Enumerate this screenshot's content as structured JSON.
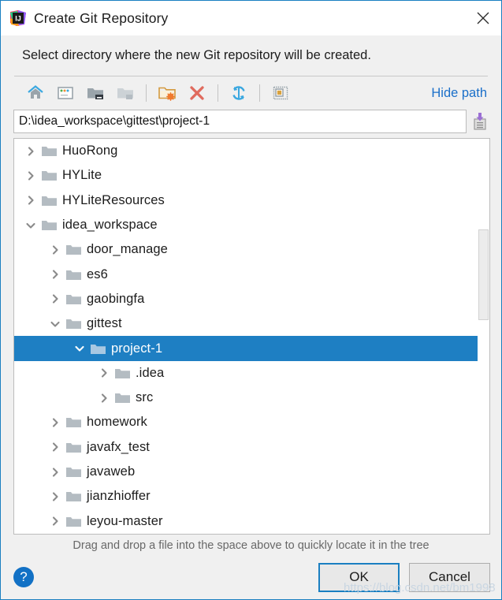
{
  "window": {
    "title": "Create Git Repository",
    "app_icon": "intellij-idea-icon",
    "close_icon": "close-icon"
  },
  "prompt": "Select directory where the new Git repository will be created.",
  "toolbar": {
    "buttons": [
      {
        "name": "home-icon",
        "tooltip": "Home"
      },
      {
        "name": "desktop-icon",
        "tooltip": "Desktop"
      },
      {
        "name": "project-folder-icon",
        "tooltip": "Project Directory"
      },
      {
        "name": "module-folder-icon",
        "tooltip": "Module Directory"
      },
      {
        "name": "new-folder-icon",
        "tooltip": "New Folder"
      },
      {
        "name": "delete-icon",
        "tooltip": "Delete"
      },
      {
        "name": "refresh-icon",
        "tooltip": "Refresh"
      },
      {
        "name": "show-hidden-icon",
        "tooltip": "Show Hidden Files"
      }
    ],
    "hide_path_label": "Hide path"
  },
  "path": {
    "value": "D:\\idea_workspace\\gittest\\project-1",
    "placeholder": "",
    "paste_icon": "paste-from-clipboard-icon"
  },
  "tree": {
    "rows": [
      {
        "label": "HuoRong",
        "depth": 1,
        "state": "collapsed",
        "selected": false
      },
      {
        "label": "HYLite",
        "depth": 1,
        "state": "collapsed",
        "selected": false
      },
      {
        "label": "HYLiteResources",
        "depth": 1,
        "state": "collapsed",
        "selected": false
      },
      {
        "label": "idea_workspace",
        "depth": 1,
        "state": "expanded",
        "selected": false
      },
      {
        "label": "door_manage",
        "depth": 2,
        "state": "collapsed",
        "selected": false
      },
      {
        "label": "es6",
        "depth": 2,
        "state": "collapsed",
        "selected": false
      },
      {
        "label": "gaobingfa",
        "depth": 2,
        "state": "collapsed",
        "selected": false
      },
      {
        "label": "gittest",
        "depth": 2,
        "state": "expanded",
        "selected": false
      },
      {
        "label": "project-1",
        "depth": 3,
        "state": "expanded",
        "selected": true
      },
      {
        "label": ".idea",
        "depth": 4,
        "state": "collapsed",
        "selected": false
      },
      {
        "label": "src",
        "depth": 4,
        "state": "collapsed",
        "selected": false
      },
      {
        "label": "homework",
        "depth": 2,
        "state": "collapsed",
        "selected": false
      },
      {
        "label": "javafx_test",
        "depth": 2,
        "state": "collapsed",
        "selected": false
      },
      {
        "label": "javaweb",
        "depth": 2,
        "state": "collapsed",
        "selected": false
      },
      {
        "label": "jianzhioffer",
        "depth": 2,
        "state": "collapsed",
        "selected": false
      },
      {
        "label": "leyou-master",
        "depth": 2,
        "state": "collapsed",
        "selected": false
      }
    ],
    "scrollbar": {
      "thumb_top_pct": 23,
      "thumb_height_pct": 23
    }
  },
  "hint": "Drag and drop a file into the space above to quickly locate it in the tree",
  "footer": {
    "help_label": "?",
    "ok_label": "OK",
    "cancel_label": "Cancel"
  },
  "watermark": "https://blog.csdn.net/bm1998",
  "colors": {
    "selection_blue": "#1e7fc3",
    "link_blue": "#1a6fc9",
    "accent_border": "#1a7fc1",
    "dialog_bg": "#f0f0f0",
    "folder_gray": "#b4bcc2"
  }
}
